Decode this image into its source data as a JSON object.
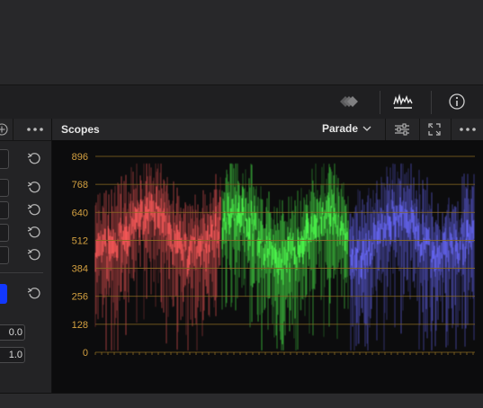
{
  "scopes": {
    "title": "Scopes",
    "mode": "Parade",
    "scale_labels": [
      "896",
      "768",
      "640",
      "512",
      "384",
      "256",
      "128",
      "0"
    ]
  },
  "left_panel": {
    "field_values": [
      "0.0",
      "1.0"
    ],
    "swatch_color": "#1238ff"
  },
  "colors": {
    "scale_text": "#d3a040",
    "graticule": "#8a6a22",
    "red_trace": "#ff5a5a",
    "green_trace": "#4dff4d",
    "blue_trace": "#6a6aff"
  },
  "icons": {
    "viewer_overlay": "layered-diamonds-icon",
    "scopes": "waveform-icon",
    "info": "info-icon",
    "options": "sliders-icon",
    "expand": "expand-icon",
    "more": "ellipsis-icon"
  }
}
